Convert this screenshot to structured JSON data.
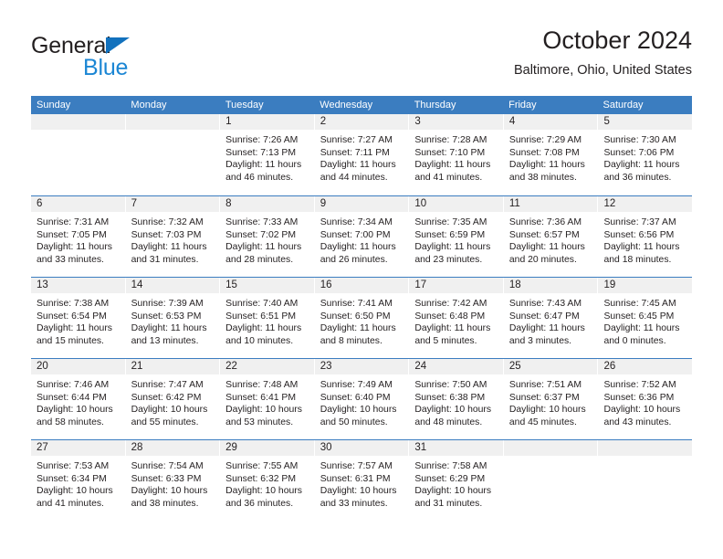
{
  "brand": {
    "name_part1": "General",
    "name_part2": "Blue",
    "triangle_icon": "triangle-icon",
    "color_dark": "#231f20",
    "color_blue": "#1b86d4"
  },
  "header": {
    "title": "October 2024",
    "subtitle": "Baltimore, Ohio, United States"
  },
  "theme": {
    "header_blue": "#3b7dc0",
    "daynum_band": "#f0f0f0",
    "text": "#231f20"
  },
  "weekdays": [
    "Sunday",
    "Monday",
    "Tuesday",
    "Wednesday",
    "Thursday",
    "Friday",
    "Saturday"
  ],
  "weeks": [
    [
      {
        "day": "",
        "lines": []
      },
      {
        "day": "",
        "lines": []
      },
      {
        "day": "1",
        "lines": [
          "Sunrise: 7:26 AM",
          "Sunset: 7:13 PM",
          "Daylight: 11 hours",
          "and 46 minutes."
        ]
      },
      {
        "day": "2",
        "lines": [
          "Sunrise: 7:27 AM",
          "Sunset: 7:11 PM",
          "Daylight: 11 hours",
          "and 44 minutes."
        ]
      },
      {
        "day": "3",
        "lines": [
          "Sunrise: 7:28 AM",
          "Sunset: 7:10 PM",
          "Daylight: 11 hours",
          "and 41 minutes."
        ]
      },
      {
        "day": "4",
        "lines": [
          "Sunrise: 7:29 AM",
          "Sunset: 7:08 PM",
          "Daylight: 11 hours",
          "and 38 minutes."
        ]
      },
      {
        "day": "5",
        "lines": [
          "Sunrise: 7:30 AM",
          "Sunset: 7:06 PM",
          "Daylight: 11 hours",
          "and 36 minutes."
        ]
      }
    ],
    [
      {
        "day": "6",
        "lines": [
          "Sunrise: 7:31 AM",
          "Sunset: 7:05 PM",
          "Daylight: 11 hours",
          "and 33 minutes."
        ]
      },
      {
        "day": "7",
        "lines": [
          "Sunrise: 7:32 AM",
          "Sunset: 7:03 PM",
          "Daylight: 11 hours",
          "and 31 minutes."
        ]
      },
      {
        "day": "8",
        "lines": [
          "Sunrise: 7:33 AM",
          "Sunset: 7:02 PM",
          "Daylight: 11 hours",
          "and 28 minutes."
        ]
      },
      {
        "day": "9",
        "lines": [
          "Sunrise: 7:34 AM",
          "Sunset: 7:00 PM",
          "Daylight: 11 hours",
          "and 26 minutes."
        ]
      },
      {
        "day": "10",
        "lines": [
          "Sunrise: 7:35 AM",
          "Sunset: 6:59 PM",
          "Daylight: 11 hours",
          "and 23 minutes."
        ]
      },
      {
        "day": "11",
        "lines": [
          "Sunrise: 7:36 AM",
          "Sunset: 6:57 PM",
          "Daylight: 11 hours",
          "and 20 minutes."
        ]
      },
      {
        "day": "12",
        "lines": [
          "Sunrise: 7:37 AM",
          "Sunset: 6:56 PM",
          "Daylight: 11 hours",
          "and 18 minutes."
        ]
      }
    ],
    [
      {
        "day": "13",
        "lines": [
          "Sunrise: 7:38 AM",
          "Sunset: 6:54 PM",
          "Daylight: 11 hours",
          "and 15 minutes."
        ]
      },
      {
        "day": "14",
        "lines": [
          "Sunrise: 7:39 AM",
          "Sunset: 6:53 PM",
          "Daylight: 11 hours",
          "and 13 minutes."
        ]
      },
      {
        "day": "15",
        "lines": [
          "Sunrise: 7:40 AM",
          "Sunset: 6:51 PM",
          "Daylight: 11 hours",
          "and 10 minutes."
        ]
      },
      {
        "day": "16",
        "lines": [
          "Sunrise: 7:41 AM",
          "Sunset: 6:50 PM",
          "Daylight: 11 hours",
          "and 8 minutes."
        ]
      },
      {
        "day": "17",
        "lines": [
          "Sunrise: 7:42 AM",
          "Sunset: 6:48 PM",
          "Daylight: 11 hours",
          "and 5 minutes."
        ]
      },
      {
        "day": "18",
        "lines": [
          "Sunrise: 7:43 AM",
          "Sunset: 6:47 PM",
          "Daylight: 11 hours",
          "and 3 minutes."
        ]
      },
      {
        "day": "19",
        "lines": [
          "Sunrise: 7:45 AM",
          "Sunset: 6:45 PM",
          "Daylight: 11 hours",
          "and 0 minutes."
        ]
      }
    ],
    [
      {
        "day": "20",
        "lines": [
          "Sunrise: 7:46 AM",
          "Sunset: 6:44 PM",
          "Daylight: 10 hours",
          "and 58 minutes."
        ]
      },
      {
        "day": "21",
        "lines": [
          "Sunrise: 7:47 AM",
          "Sunset: 6:42 PM",
          "Daylight: 10 hours",
          "and 55 minutes."
        ]
      },
      {
        "day": "22",
        "lines": [
          "Sunrise: 7:48 AM",
          "Sunset: 6:41 PM",
          "Daylight: 10 hours",
          "and 53 minutes."
        ]
      },
      {
        "day": "23",
        "lines": [
          "Sunrise: 7:49 AM",
          "Sunset: 6:40 PM",
          "Daylight: 10 hours",
          "and 50 minutes."
        ]
      },
      {
        "day": "24",
        "lines": [
          "Sunrise: 7:50 AM",
          "Sunset: 6:38 PM",
          "Daylight: 10 hours",
          "and 48 minutes."
        ]
      },
      {
        "day": "25",
        "lines": [
          "Sunrise: 7:51 AM",
          "Sunset: 6:37 PM",
          "Daylight: 10 hours",
          "and 45 minutes."
        ]
      },
      {
        "day": "26",
        "lines": [
          "Sunrise: 7:52 AM",
          "Sunset: 6:36 PM",
          "Daylight: 10 hours",
          "and 43 minutes."
        ]
      }
    ],
    [
      {
        "day": "27",
        "lines": [
          "Sunrise: 7:53 AM",
          "Sunset: 6:34 PM",
          "Daylight: 10 hours",
          "and 41 minutes."
        ]
      },
      {
        "day": "28",
        "lines": [
          "Sunrise: 7:54 AM",
          "Sunset: 6:33 PM",
          "Daylight: 10 hours",
          "and 38 minutes."
        ]
      },
      {
        "day": "29",
        "lines": [
          "Sunrise: 7:55 AM",
          "Sunset: 6:32 PM",
          "Daylight: 10 hours",
          "and 36 minutes."
        ]
      },
      {
        "day": "30",
        "lines": [
          "Sunrise: 7:57 AM",
          "Sunset: 6:31 PM",
          "Daylight: 10 hours",
          "and 33 minutes."
        ]
      },
      {
        "day": "31",
        "lines": [
          "Sunrise: 7:58 AM",
          "Sunset: 6:29 PM",
          "Daylight: 10 hours",
          "and 31 minutes."
        ]
      },
      {
        "day": "",
        "lines": []
      },
      {
        "day": "",
        "lines": []
      }
    ]
  ]
}
